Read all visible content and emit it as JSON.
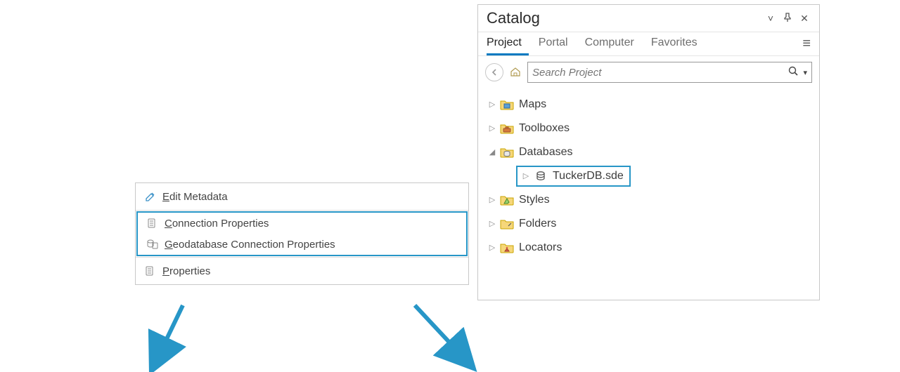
{
  "catalog": {
    "title": "Catalog",
    "tabs": [
      "Project",
      "Portal",
      "Computer",
      "Favorites"
    ],
    "activeTab": 0,
    "searchPlaceholder": "Search Project",
    "items": [
      {
        "label": "Maps",
        "expanded": false
      },
      {
        "label": "Toolboxes",
        "expanded": false
      },
      {
        "label": "Databases",
        "expanded": true,
        "children": [
          {
            "label": "TuckerDB.sde",
            "highlighted": true
          }
        ]
      },
      {
        "label": "Styles",
        "expanded": false
      },
      {
        "label": "Folders",
        "expanded": false
      },
      {
        "label": "Locators",
        "expanded": false
      }
    ]
  },
  "menu": {
    "items": [
      {
        "accel": "E",
        "rest": "dit Metadata",
        "icon": "pencil"
      },
      {
        "accel": "C",
        "rest": "onnection Properties",
        "icon": "doc",
        "hl": true
      },
      {
        "accel": "G",
        "rest": "eodatabase Connection Properties",
        "icon": "db",
        "hl": true
      },
      {
        "accel": "P",
        "rest": "roperties",
        "icon": "doc"
      }
    ]
  },
  "colors": {
    "accent": "#2796c7",
    "tabActive": "#0079c1"
  }
}
